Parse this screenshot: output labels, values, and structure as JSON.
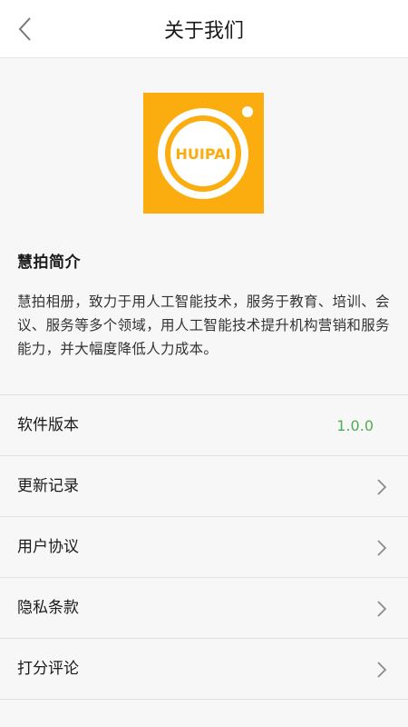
{
  "header": {
    "title": "关于我们",
    "back_icon": "chevron-left-icon"
  },
  "logo": {
    "text": "HUIPAI",
    "bg_color": "#fbad0f"
  },
  "intro": {
    "title": "慧拍简介",
    "text": "慧拍相册，致力于用人工智能技术，服务于教育、培训、会议、服务等多个领域，用人工智能技术提升机构营销和服务能力，并大幅度降低人力成本。"
  },
  "list": {
    "items": [
      {
        "label": "软件版本",
        "value": "1.0.0"
      },
      {
        "label": "更新记录"
      },
      {
        "label": "用户协议"
      },
      {
        "label": "隐私条款"
      },
      {
        "label": "打分评论"
      }
    ]
  },
  "colors": {
    "version_text": "#4caf50",
    "accent": "#fbad0f"
  }
}
